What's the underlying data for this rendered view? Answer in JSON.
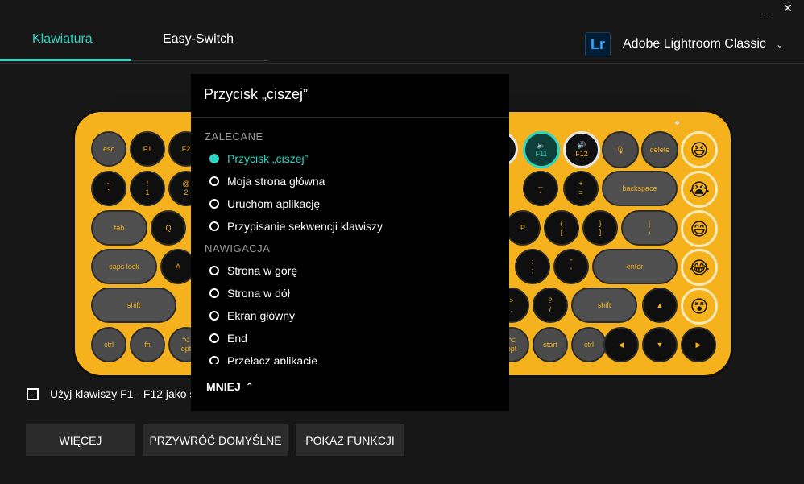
{
  "window": {
    "minimize": "_",
    "close": "✕"
  },
  "tabs": [
    {
      "label": "Klawiatura",
      "active": true
    },
    {
      "label": "Easy-Switch",
      "active": false
    }
  ],
  "app_selector": {
    "badge": "Lr",
    "name": "Adobe Lightroom Classic",
    "chevron": "⌄"
  },
  "colors": {
    "accent": "#2fd4c3",
    "keyboard_body": "#f5b21c",
    "panel": "#000000"
  },
  "keys": {
    "esc": "esc",
    "f1": "F1",
    "f2": "F2",
    "f11": "F11",
    "f12": "F12",
    "delete": "delete",
    "tilde": "~\n`",
    "one": "!\n1",
    "two": "@\n2",
    "minus": "_\n-",
    "plus": "+\n=",
    "backspace": "backspace",
    "tab": "tab",
    "q": "Q",
    "p": "P",
    "lbrace": "{\n[",
    "rbrace": "}\n]",
    "pipe": "|\n\\",
    "capslock": "caps lock",
    "a": "A",
    "colon": ":\n;",
    "quote": "\"\n'",
    "enter": "enter",
    "shift_left": "shift",
    "gt": ">\n.",
    "question": "?\n/",
    "shift_right": "shift",
    "up": "▲",
    "ctrl_left": "ctrl",
    "fn": "fn",
    "opt": "⌥\nopt",
    "opt_right": "⌥\nopt",
    "start": "start",
    "ctrl_right": "ctrl",
    "left": "◀",
    "down": "▼",
    "right": "▶"
  },
  "emoji_keys": [
    "😆",
    "😭",
    "😄",
    "😂",
    "😵"
  ],
  "dropdown": {
    "title": "Przycisk „ciszej”",
    "sections": [
      {
        "label": "ZALECANE",
        "items": [
          {
            "label": "Przycisk „ciszej”",
            "selected": true
          },
          {
            "label": "Moja strona główna",
            "selected": false
          },
          {
            "label": "Uruchom aplikację",
            "selected": false
          },
          {
            "label": "Przypisanie sekwencji klawiszy",
            "selected": false
          }
        ]
      },
      {
        "label": "NAWIGACJA",
        "items": [
          {
            "label": "Strona w górę",
            "selected": false
          },
          {
            "label": "Strona w dół",
            "selected": false
          },
          {
            "label": "Ekran główny",
            "selected": false
          },
          {
            "label": "End",
            "selected": false
          },
          {
            "label": "Przełącz aplikacje",
            "selected": false
          }
        ]
      }
    ],
    "less_label": "MNIEJ"
  },
  "fkeys_option": {
    "label": "Użyj klawiszy F1 - F12 jako s",
    "checked": false
  },
  "buttons": {
    "more": "WIĘCEJ",
    "reset": "PRZYWRÓĆ DOMYŚLNE",
    "demo": "POKAZ FUNKCJI"
  }
}
